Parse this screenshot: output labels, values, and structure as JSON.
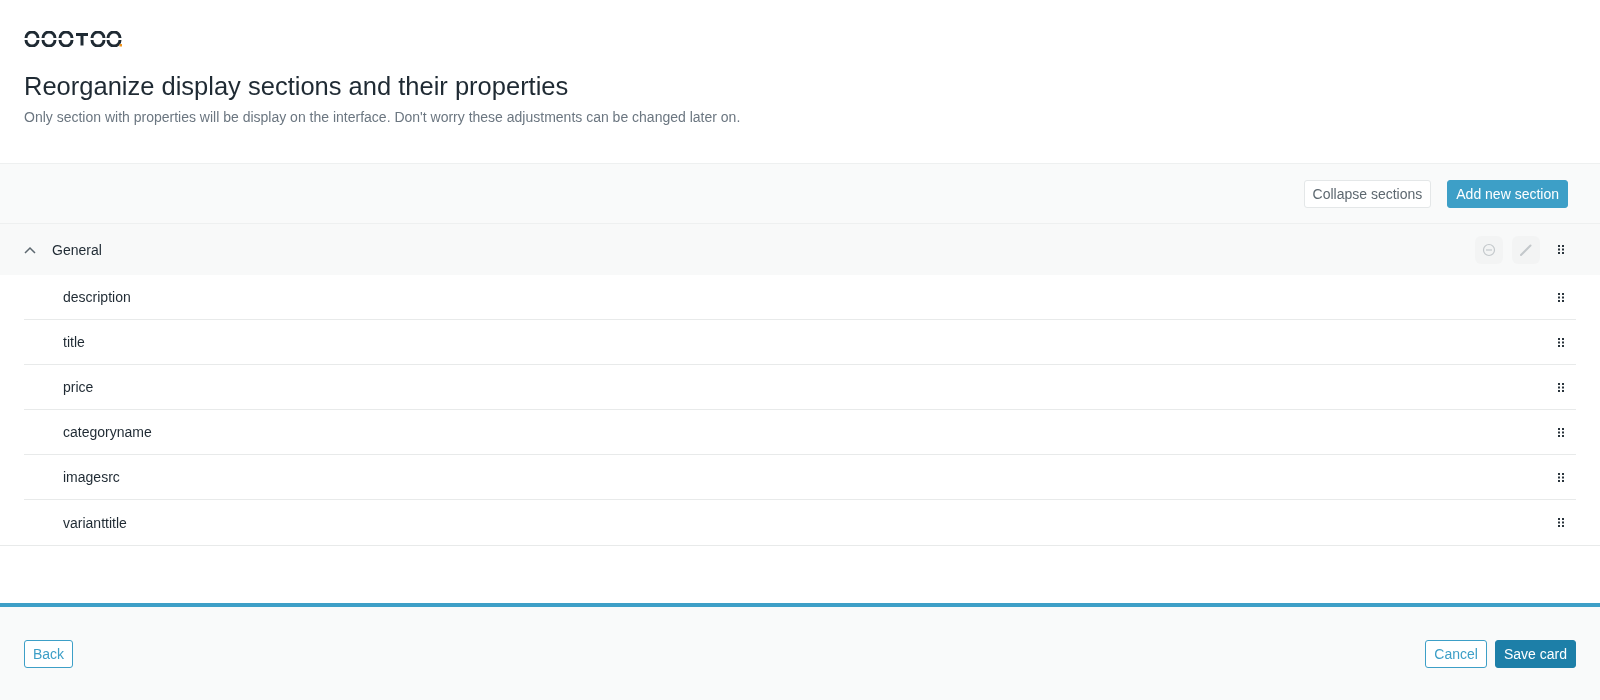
{
  "header": {
    "title": "Reorganize display sections and their properties",
    "subtitle": "Only section with properties will be display on the interface. Don't worry these adjustments can be changed later on."
  },
  "toolbar": {
    "buttons": [
      {
        "label": "Collapse sections",
        "kind": "secondary"
      },
      {
        "label": "Add new section",
        "kind": "primary"
      }
    ]
  },
  "sections": [
    {
      "name": "General",
      "expanded": true,
      "properties": [
        "description",
        "title",
        "price",
        "categoryname",
        "imagesrc",
        "varianttitle"
      ]
    }
  ],
  "progress": {
    "level": 1
  },
  "footer": {
    "left_buttons": [
      {
        "label": "Back",
        "kind": "outline"
      }
    ],
    "right_buttons": [
      {
        "label": "Cancel",
        "kind": "outline"
      },
      {
        "label": "Save card",
        "kind": "primary"
      }
    ]
  }
}
